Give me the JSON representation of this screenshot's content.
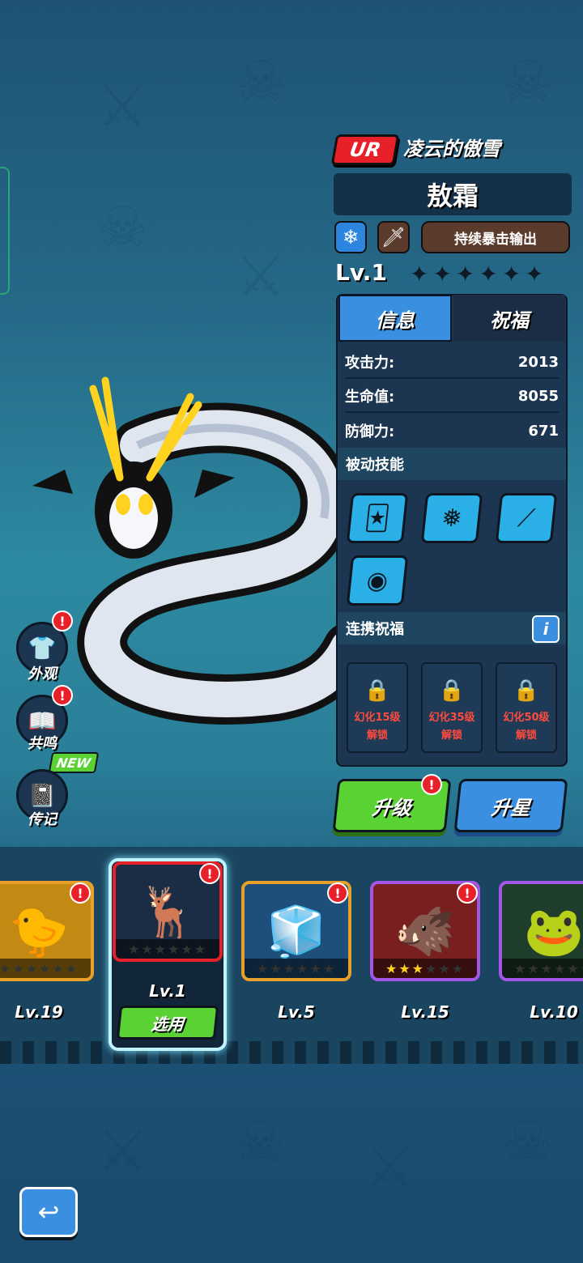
{
  "header": {
    "rarity": "UR",
    "title": "凌云的傲雪",
    "name": "敖霜",
    "element_icon": "snowflake-icon",
    "class_icon": "sword-icon",
    "role": "持续暴击输出",
    "level": "Lv.1",
    "stars_filled": 0,
    "stars_total": 6
  },
  "tabs": [
    {
      "label": "信息"
    },
    {
      "label": "祝福"
    }
  ],
  "stats": [
    {
      "label": "攻击力:",
      "value": "2013"
    },
    {
      "label": "生命值:",
      "value": "8055"
    },
    {
      "label": "防御力:",
      "value": "671"
    }
  ],
  "passive": {
    "title": "被动技能",
    "skills": [
      "cards-dice-icon",
      "snowflakes-icon",
      "claw-slash-icon",
      "dragon-emblem-icon"
    ]
  },
  "link_bless": {
    "title": "连携祝福",
    "info": "i",
    "slots": [
      {
        "line1": "幻化15级",
        "line2": "解锁"
      },
      {
        "line1": "幻化35级",
        "line2": "解锁"
      },
      {
        "line1": "幻化50级",
        "line2": "解锁"
      }
    ]
  },
  "actions": {
    "upgrade": "升级",
    "star_up": "升星"
  },
  "side": {
    "appearance": "外观",
    "resonance": "共鸣",
    "biography": "传记",
    "new": "NEW",
    "alert": "!"
  },
  "roster": [
    {
      "level": "Lv.19",
      "stars": "★★★★★★",
      "border": "#e8a02a",
      "color": "#c28a12"
    },
    {
      "level": "Lv.1",
      "stars": "★★★★★★",
      "border": "#e8202a",
      "color": "#1a2d45",
      "selected": true,
      "use": "选用"
    },
    {
      "level": "Lv.5",
      "stars": "★★★★★★",
      "border": "#e8a02a",
      "color": "#1d4f7a"
    },
    {
      "level": "Lv.15",
      "stars": "★★★★★★",
      "border": "#a455e6",
      "color": "#7a1f1f",
      "stars_filled": 3
    },
    {
      "level": "Lv.10",
      "stars": "★★★★★★",
      "border": "#a455e6",
      "color": "#1e3d2a"
    }
  ],
  "colors": {
    "accent_green": "#5bd234",
    "accent_blue": "#3b8fe0",
    "alert_red": "#e8202a"
  }
}
